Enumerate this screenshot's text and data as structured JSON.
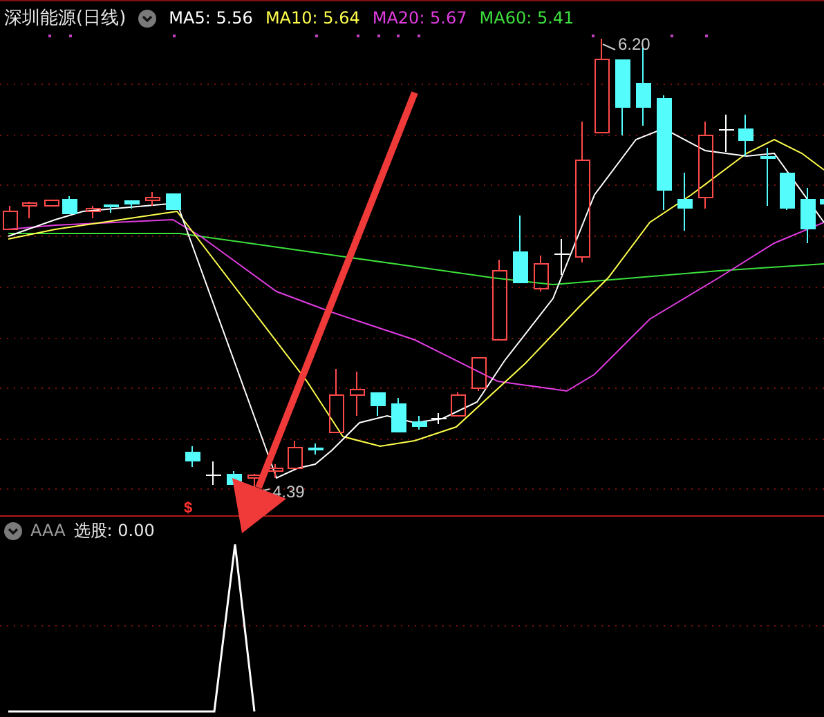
{
  "chart_header": {
    "title": "深圳能源(日线)",
    "indicators": [
      {
        "label": "MA5: 5.56",
        "color": "#ffffff"
      },
      {
        "label": "MA10: 5.64",
        "color": "#ffff4c"
      },
      {
        "label": "MA20: 5.67",
        "color": "#e03ce0"
      },
      {
        "label": "MA60: 5.41",
        "color": "#3ce03c"
      }
    ]
  },
  "price_chart": {
    "high_label": "6.20",
    "low_label": "4.39",
    "signal_mark": "$"
  },
  "indicator_panel": {
    "name": "AAA",
    "reading": "选股: 0.00"
  }
}
